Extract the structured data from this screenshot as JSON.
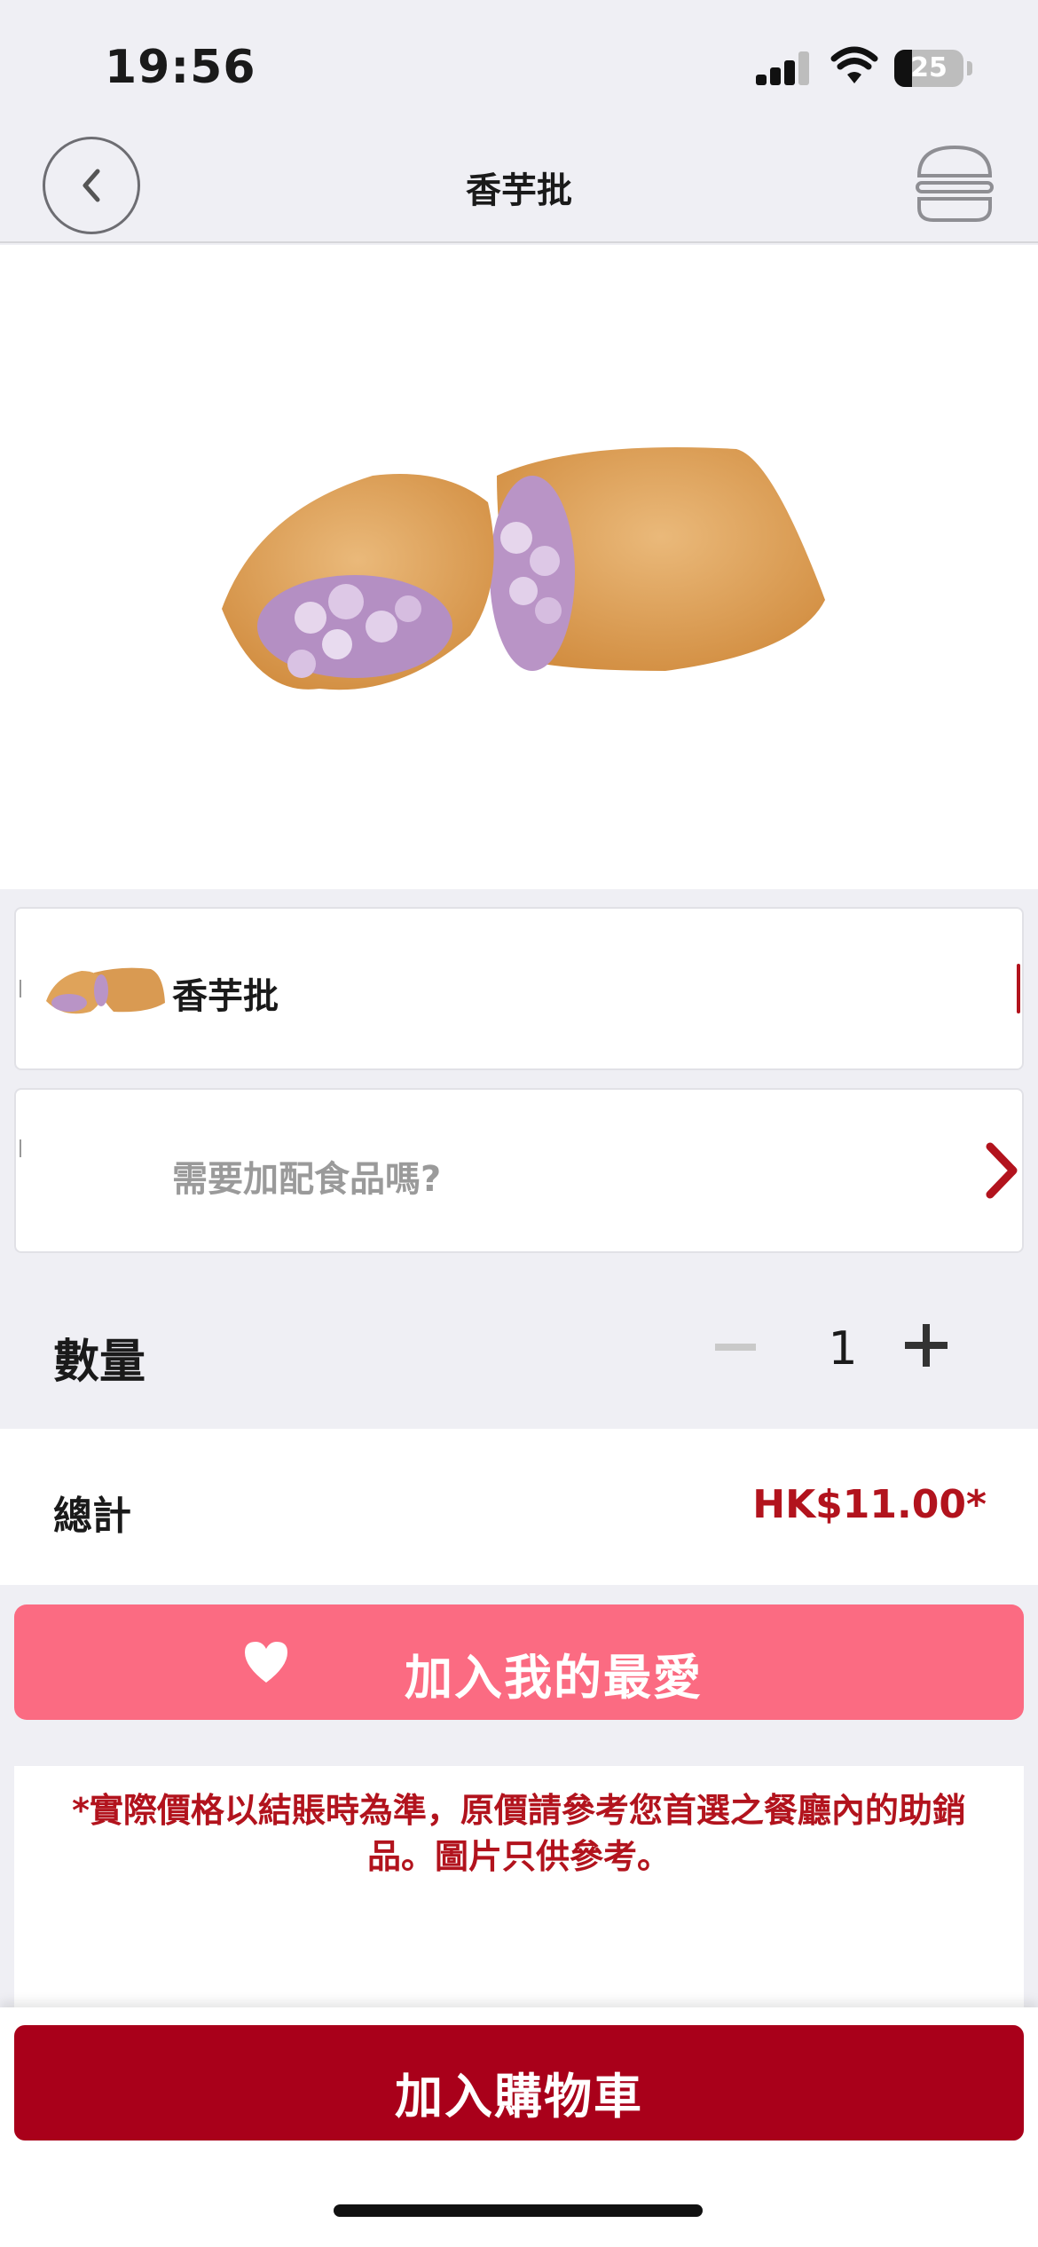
{
  "status_bar": {
    "time": "19:56",
    "battery_level": "25",
    "battery_fraction": 0.25
  },
  "header": {
    "title": "香芋批",
    "back_icon": "chevron-left-icon",
    "menu_icon": "burger-menu-icon"
  },
  "hero": {
    "image": "taro-pie-image"
  },
  "item_card": {
    "name": "香芋批",
    "thumbnail": "taro-pie-thumbnail"
  },
  "addon_card": {
    "prompt": "需要加配食品嗎?",
    "icon": "chevron-right-icon"
  },
  "quantity": {
    "label": "數量",
    "value": "1"
  },
  "total": {
    "label": "總計",
    "price": "HK$11.00*"
  },
  "favorite_button": {
    "label": "加入我的最愛",
    "icon": "heart-icon"
  },
  "notice": {
    "text": "*實際價格以結賬時為準，原價請參考您首選之餐廳內的助銷品。圖片只供參考。"
  },
  "cart_button": {
    "label": "加入購物車"
  },
  "colors": {
    "brand_red": "#a9001a",
    "price_red": "#b2131d",
    "favorite_pink": "#fb6b82",
    "background": "#efeff4"
  }
}
